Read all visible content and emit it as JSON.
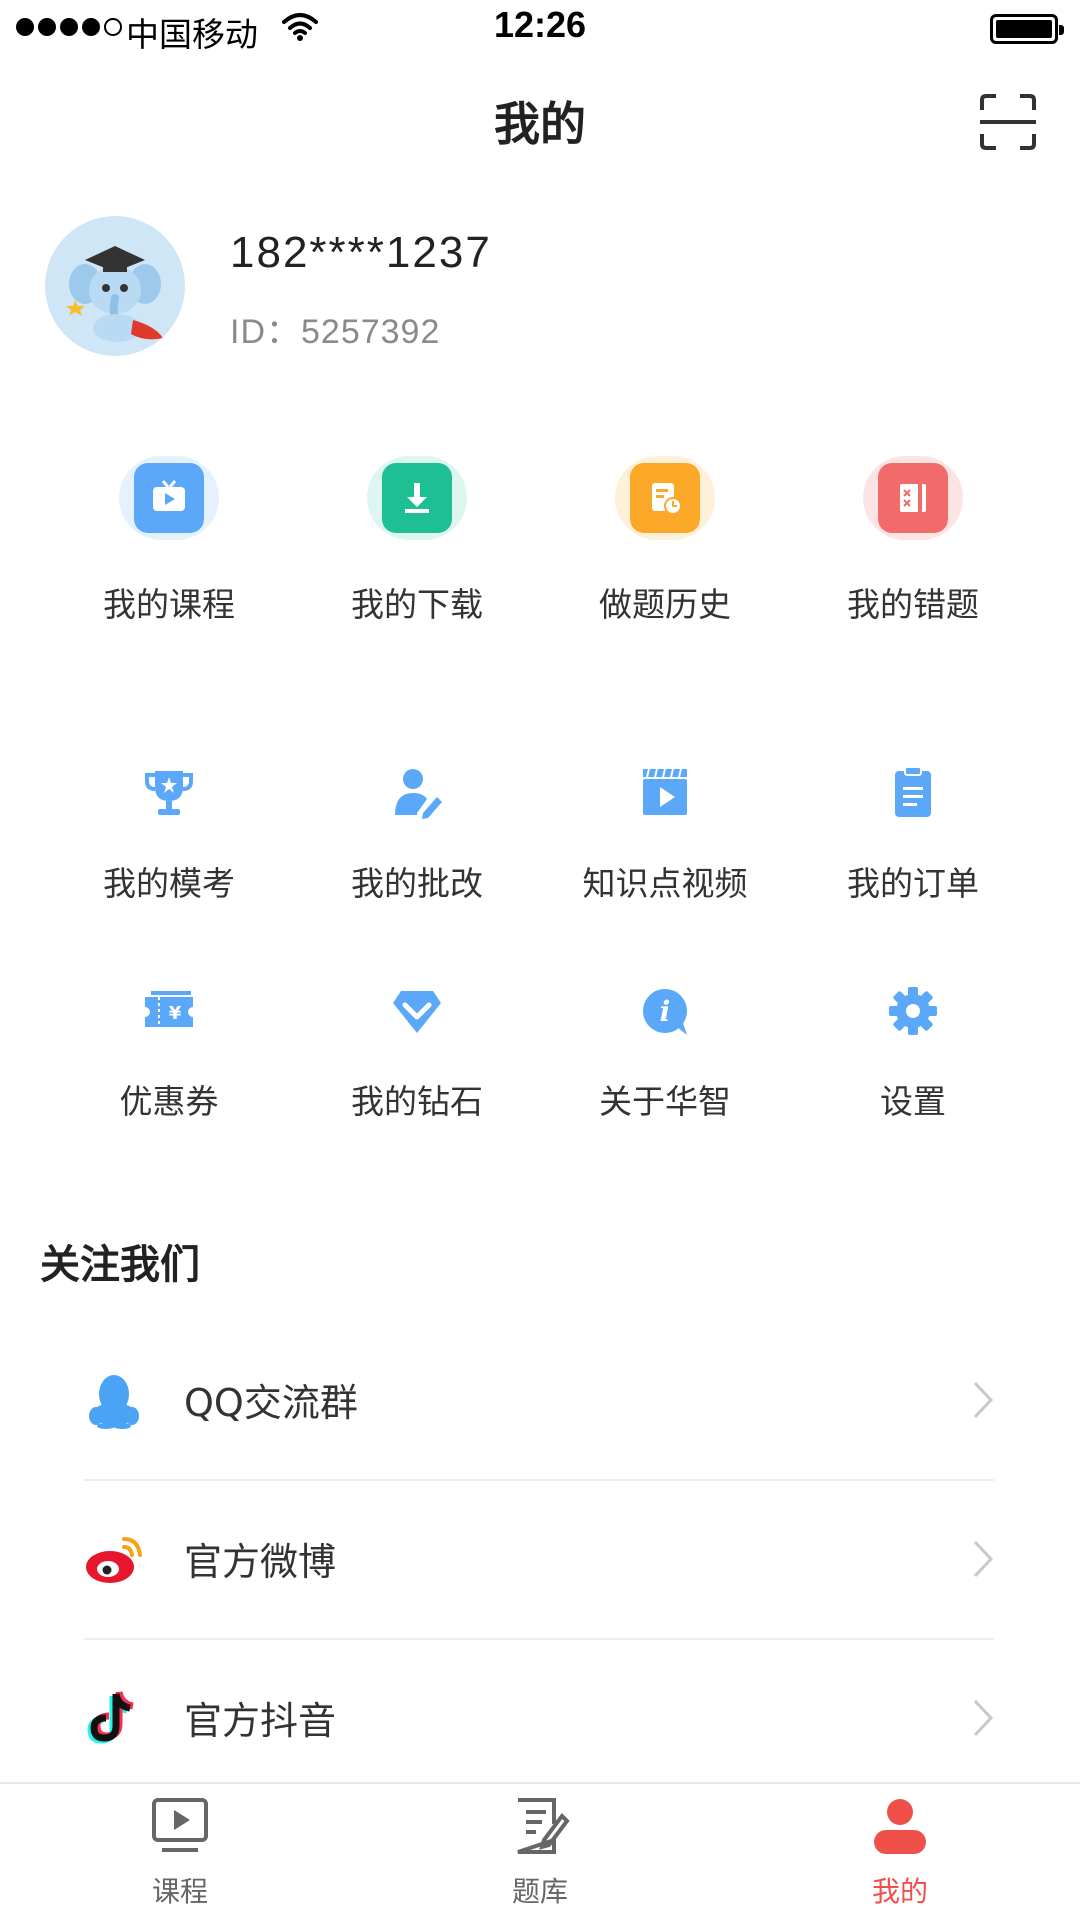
{
  "status_bar": {
    "carrier": "中国移动",
    "time": "12:26"
  },
  "nav": {
    "title": "我的"
  },
  "profile": {
    "phone": "182****1237",
    "id_text": "ID：5257392"
  },
  "main_menu": [
    {
      "label": "我的课程",
      "icon": "tv-icon",
      "color": "#5aa8f7"
    },
    {
      "label": "我的下载",
      "icon": "download-icon",
      "color": "#1fbf94"
    },
    {
      "label": "做题历史",
      "icon": "history-icon",
      "color": "#fba829"
    },
    {
      "label": "我的错题",
      "icon": "wrong-answers-icon",
      "color": "#f26b6b"
    }
  ],
  "secondary_menu": [
    {
      "label": "我的模考",
      "icon": "trophy-icon"
    },
    {
      "label": "我的批改",
      "icon": "user-edit-icon"
    },
    {
      "label": "知识点视频",
      "icon": "video-clapper-icon"
    },
    {
      "label": "我的订单",
      "icon": "order-icon"
    },
    {
      "label": "优惠券",
      "icon": "coupon-icon"
    },
    {
      "label": "我的钻石",
      "icon": "diamond-icon"
    },
    {
      "label": "关于华智",
      "icon": "info-icon"
    },
    {
      "label": "设置",
      "icon": "gear-icon"
    }
  ],
  "follow": {
    "title": "关注我们",
    "items": [
      {
        "label": "QQ交流群",
        "icon": "qq-icon"
      },
      {
        "label": "官方微博",
        "icon": "weibo-icon"
      },
      {
        "label": "官方抖音",
        "icon": "douyin-icon"
      }
    ]
  },
  "tab_bar": {
    "items": [
      {
        "label": "课程",
        "icon": "course-play-icon",
        "active": false
      },
      {
        "label": "题库",
        "icon": "question-bank-icon",
        "active": false
      },
      {
        "label": "我的",
        "icon": "profile-icon",
        "active": true
      }
    ]
  },
  "colors": {
    "accent_blue": "#5aa8f7",
    "active_red": "#f0504a"
  }
}
